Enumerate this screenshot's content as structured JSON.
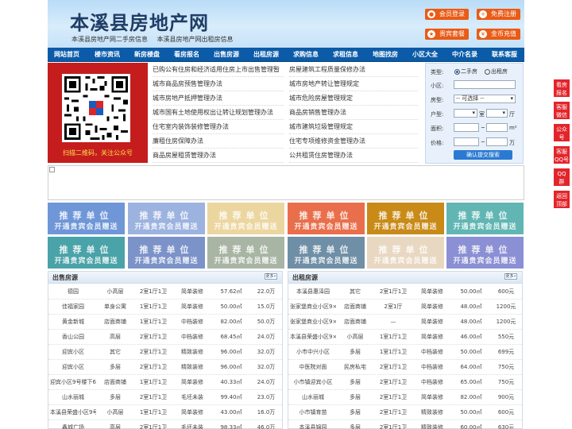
{
  "header": {
    "title": "本溪县房地产网",
    "subtitle": [
      "本溪县房地产网二手房信息",
      "本溪县房地产网出租房信息"
    ],
    "buttons": {
      "login": "会员登录",
      "register": "免费注册",
      "vip": "贵宾套餐",
      "recharge": "金币充值"
    }
  },
  "nav": [
    "网站首页",
    "楼市资讯",
    "新房楼盘",
    "看房报名",
    "出售房源",
    "出租房源",
    "求购信息",
    "求租信息",
    "地图找房",
    "小区大全",
    "中介名录",
    "联系客服"
  ],
  "qr": {
    "caption": "扫描二维码，关注公众号"
  },
  "news": {
    "left": [
      "已购公有住房和经济适用住房上市出售管理暂",
      "城市商品房预售管理办法",
      "城市房地产抵押管理办法",
      "城市国有土地使用权出让转让规划管理办法",
      "住宅室内装饰装修管理办法",
      "廉租住房保障办法",
      "商品房屋租赁管理办法"
    ],
    "right": [
      "房屋建筑工程质量保修办法",
      "城市房地产转让管理规定",
      "城市危险房屋管理规定",
      "商品房销售管理办法",
      "城市建筑垃圾管理规定",
      "住宅专项维修资金管理办法",
      "公共租赁住房管理办法"
    ]
  },
  "search": {
    "type_label": "类型:",
    "type_options": [
      "二手房",
      "出租房"
    ],
    "community_label": "小区:",
    "house_label": "房型:",
    "house_value": "-- 可选择 --",
    "layout_label": "户型:",
    "room_unit": "室",
    "hall_unit": "厅",
    "area_label": "面积:",
    "area_unit": "m²",
    "price_label": "价格:",
    "to_sep": "~",
    "price_unit": "万",
    "submit": "确认提交搜索"
  },
  "ads": {
    "line1": "推荐单位",
    "line2": "开通贵宾会员赠送",
    "colors": [
      "#6f97d8",
      "#9cb3e0",
      "#ecd6a0",
      "#e96f4c",
      "#c98a17",
      "#61b6b3",
      "#4aa3a8",
      "#7c93c9",
      "#a9b5a4",
      "#6f8fa6",
      "#e8d8c2",
      "#8b8fd4"
    ]
  },
  "sale": {
    "title": "出售房源",
    "more": "更多»",
    "rows": [
      [
        "德园",
        "小高层",
        "2室1厅1卫",
        "简单装修",
        "57.62㎡",
        "22.0万"
      ],
      [
        "佳福家园",
        "单身公寓",
        "1室1厅1卫",
        "简单装修",
        "50.00㎡",
        "15.0万"
      ],
      [
        "黄金新城",
        "店面商铺",
        "1室1厅1卫",
        "中档装修",
        "82.00㎡",
        "50.0万"
      ],
      [
        "香山公园",
        "高层",
        "2室1厅1卫",
        "中档装修",
        "68.45㎡",
        "24.0万"
      ],
      [
        "迎宾小区",
        "其它",
        "2室1厅1卫",
        "精致装修",
        "96.00㎡",
        "32.0万"
      ],
      [
        "迎宾小区",
        "多层",
        "2室1厅1卫",
        "精致装修",
        "96.00㎡",
        "32.0万"
      ],
      [
        "迎宾小区9号楼下6号",
        "店面商铺",
        "1室1厅1卫",
        "简单装修",
        "40.33㎡",
        "24.0万"
      ],
      [
        "山水丽城",
        "多层",
        "2室1厅1卫",
        "毛坯未装",
        "99.40㎡",
        "23.0万"
      ],
      [
        "本溪县荣盛小区9号楼",
        "小高层",
        "1室1厅1卫",
        "简单装修",
        "43.00㎡",
        "16.0万"
      ],
      [
        "鑫城广场",
        "高层",
        "2室1厅1卫",
        "毛坯未装",
        "98.33㎡",
        "46.0万"
      ]
    ]
  },
  "rent": {
    "title": "出租房源",
    "more": "更多»",
    "rows": [
      [
        "本溪县惠泽园",
        "其它",
        "2室1厅1卫",
        "简单装修",
        "50.00㎡",
        "600元"
      ],
      [
        "张家堡商业小区9×楼",
        "店面商铺",
        "2室1厅",
        "简单装修",
        "48.00㎡",
        "1200元"
      ],
      [
        "张家堡商业小区9×楼",
        "店面商铺",
        "—",
        "简单装修",
        "48.00㎡",
        "1200元"
      ],
      [
        "本溪县荣盛小区9×楼",
        "小高层",
        "1室1厅1卫",
        "简单装修",
        "46.00㎡",
        "550元"
      ],
      [
        "小市中兴小区",
        "多层",
        "1室1厅1卫",
        "中档装修",
        "50.00㎡",
        "699元"
      ],
      [
        "中医院对面",
        "民房私宅",
        "2室1厅1卫",
        "中档装修",
        "64.00㎡",
        "750元"
      ],
      [
        "小市镇迎宾小区",
        "多层",
        "2室1厅1卫",
        "中档装修",
        "65.00㎡",
        "750元"
      ],
      [
        "山水丽城",
        "多层",
        "2室1厅1卫",
        "简单装修",
        "82.00㎡",
        "900元"
      ],
      [
        "小市镇育苗",
        "多层",
        "2室1厅1卫",
        "精致装修",
        "50.00㎡",
        "600元"
      ],
      [
        "本溪县锦园",
        "多层",
        "2室1厅1卫",
        "精致装修",
        "60.00㎡",
        "630元"
      ]
    ]
  },
  "float": [
    [
      "看房",
      "报名"
    ],
    [
      "客服",
      "微信"
    ],
    [
      "公众",
      "号"
    ],
    [
      "客服",
      "QQ号"
    ],
    [
      "QQ",
      "群"
    ],
    [
      "返回",
      "顶部"
    ]
  ]
}
